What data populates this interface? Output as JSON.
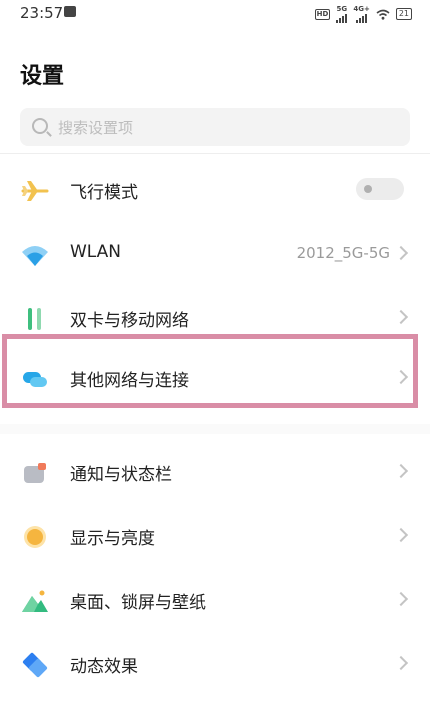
{
  "status_bar": {
    "time": "23:57",
    "hd_label": "HD",
    "net_5g": "5G",
    "net_4g": "4G+",
    "battery": "21"
  },
  "page": {
    "title": "设置",
    "search_placeholder": "搜索设置项"
  },
  "settings": [
    {
      "label": "飞行模式",
      "icon": "airplane-icon",
      "control": "toggle",
      "toggle_on": false
    },
    {
      "label": "WLAN",
      "icon": "wifi-icon",
      "value": "2012_5G-5G"
    },
    {
      "label": "双卡与移动网络",
      "icon": "sim-cards-icon"
    },
    {
      "label": "其他网络与连接",
      "icon": "connections-icon",
      "highlighted": true
    },
    {
      "label": "通知与状态栏",
      "icon": "notification-icon"
    },
    {
      "label": "显示与亮度",
      "icon": "brightness-icon"
    },
    {
      "label": "桌面、锁屏与壁纸",
      "icon": "wallpaper-icon"
    },
    {
      "label": "动态效果",
      "icon": "animation-icon"
    }
  ],
  "colors": {
    "highlight_border": "#d98da6",
    "airplane": "#f2c24f",
    "wifi": "#2ba0e6",
    "sim": "#3fbf7f",
    "connections": "#27a7e8",
    "brightness": "#f5b53f",
    "wallpaper": "#33bb80",
    "animation": "#2d7ff0"
  }
}
